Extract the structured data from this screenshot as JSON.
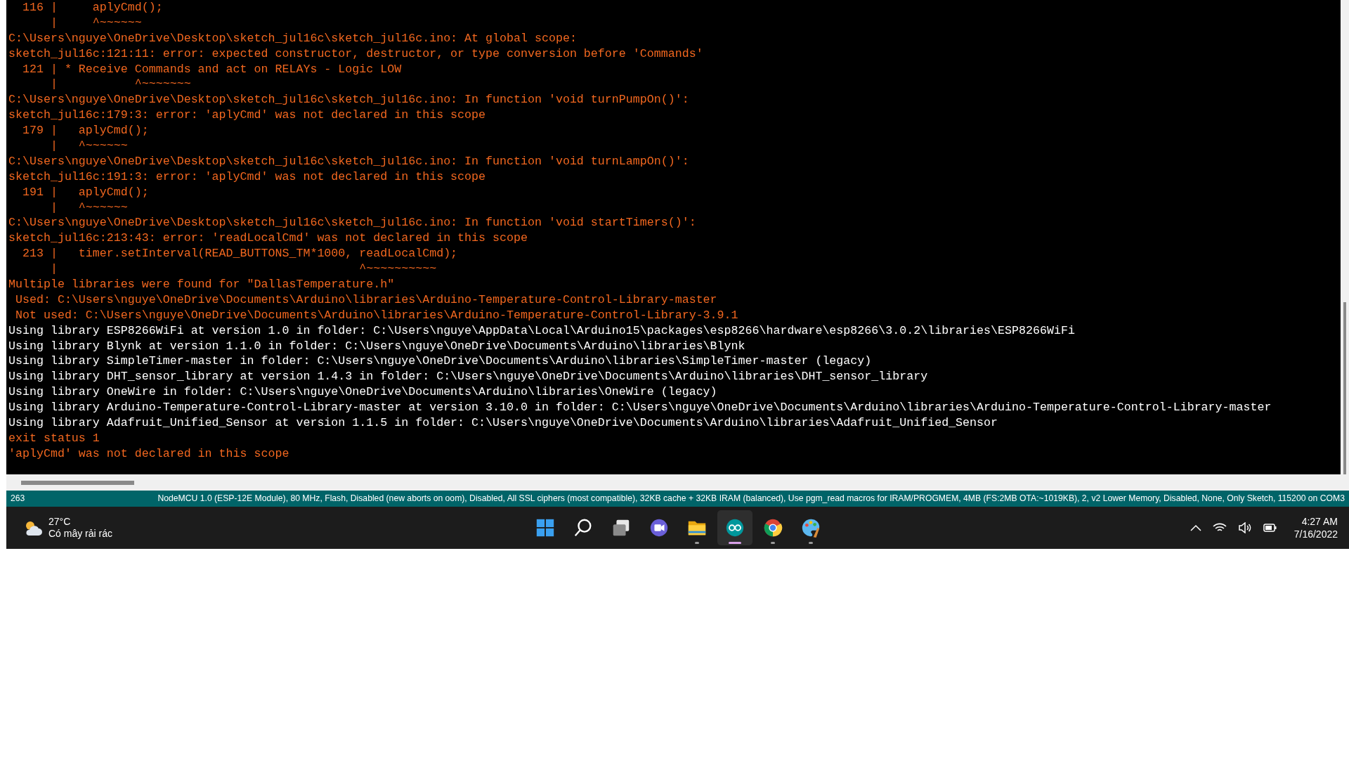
{
  "console": {
    "lines": [
      {
        "kind": "error",
        "text": "  116 |     aplyCmd();"
      },
      {
        "kind": "error",
        "text": "      |     ^~~~~~~"
      },
      {
        "kind": "error",
        "text": "C:\\Users\\nguye\\OneDrive\\Desktop\\sketch_jul16c\\sketch_jul16c.ino: At global scope:"
      },
      {
        "kind": "error",
        "text": "sketch_jul16c:121:11: error: expected constructor, destructor, or type conversion before 'Commands'"
      },
      {
        "kind": "error",
        "text": "  121 | * Receive Commands and act on RELAYs - Logic LOW"
      },
      {
        "kind": "error",
        "text": "      |           ^~~~~~~~"
      },
      {
        "kind": "error",
        "text": "C:\\Users\\nguye\\OneDrive\\Desktop\\sketch_jul16c\\sketch_jul16c.ino: In function 'void turnPumpOn()':"
      },
      {
        "kind": "error",
        "text": "sketch_jul16c:179:3: error: 'aplyCmd' was not declared in this scope"
      },
      {
        "kind": "error",
        "text": "  179 |   aplyCmd();"
      },
      {
        "kind": "error",
        "text": "      |   ^~~~~~~"
      },
      {
        "kind": "error",
        "text": "C:\\Users\\nguye\\OneDrive\\Desktop\\sketch_jul16c\\sketch_jul16c.ino: In function 'void turnLampOn()':"
      },
      {
        "kind": "error",
        "text": "sketch_jul16c:191:3: error: 'aplyCmd' was not declared in this scope"
      },
      {
        "kind": "error",
        "text": "  191 |   aplyCmd();"
      },
      {
        "kind": "error",
        "text": "      |   ^~~~~~~"
      },
      {
        "kind": "error",
        "text": "C:\\Users\\nguye\\OneDrive\\Desktop\\sketch_jul16c\\sketch_jul16c.ino: In function 'void startTimers()':"
      },
      {
        "kind": "error",
        "text": "sketch_jul16c:213:43: error: 'readLocalCmd' was not declared in this scope"
      },
      {
        "kind": "error",
        "text": "  213 |   timer.setInterval(READ_BUTTONS_TM*1000, readLocalCmd);"
      },
      {
        "kind": "error",
        "text": "      |                                           ^~~~~~~~~~~"
      },
      {
        "kind": "error",
        "text": "Multiple libraries were found for \"DallasTemperature.h\""
      },
      {
        "kind": "error",
        "text": " Used: C:\\Users\\nguye\\OneDrive\\Documents\\Arduino\\libraries\\Arduino-Temperature-Control-Library-master"
      },
      {
        "kind": "error",
        "text": " Not used: C:\\Users\\nguye\\OneDrive\\Documents\\Arduino\\libraries\\Arduino-Temperature-Control-Library-3.9.1"
      },
      {
        "kind": "info",
        "text": "Using library ESP8266WiFi at version 1.0 in folder: C:\\Users\\nguye\\AppData\\Local\\Arduino15\\packages\\esp8266\\hardware\\esp8266\\3.0.2\\libraries\\ESP8266WiFi"
      },
      {
        "kind": "info",
        "text": "Using library Blynk at version 1.1.0 in folder: C:\\Users\\nguye\\OneDrive\\Documents\\Arduino\\libraries\\Blynk"
      },
      {
        "kind": "info",
        "text": "Using library SimpleTimer-master in folder: C:\\Users\\nguye\\OneDrive\\Documents\\Arduino\\libraries\\SimpleTimer-master (legacy)"
      },
      {
        "kind": "info",
        "text": "Using library DHT_sensor_library at version 1.4.3 in folder: C:\\Users\\nguye\\OneDrive\\Documents\\Arduino\\libraries\\DHT_sensor_library"
      },
      {
        "kind": "info",
        "text": "Using library OneWire in folder: C:\\Users\\nguye\\OneDrive\\Documents\\Arduino\\libraries\\OneWire (legacy)"
      },
      {
        "kind": "info",
        "text": "Using library Arduino-Temperature-Control-Library-master at version 3.10.0 in folder: C:\\Users\\nguye\\OneDrive\\Documents\\Arduino\\libraries\\Arduino-Temperature-Control-Library-master"
      },
      {
        "kind": "info",
        "text": "Using library Adafruit_Unified_Sensor at version 1.1.5 in folder: C:\\Users\\nguye\\OneDrive\\Documents\\Arduino\\libraries\\Adafruit_Unified_Sensor"
      },
      {
        "kind": "error",
        "text": "exit status 1"
      },
      {
        "kind": "error",
        "text": "'aplyCmd' was not declared in this scope"
      }
    ]
  },
  "status_bar": {
    "line_number": "263",
    "board": "NodeMCU 1.0 (ESP-12E Module), 80 MHz, Flash, Disabled (new aborts on oom), Disabled, All SSL ciphers (most compatible), 32KB cache + 32KB IRAM (balanced), Use pgm_read macros for IRAM/PROGMEM, 4MB (FS:2MB OTA:~1019KB), 2, v2 Lower Memory, Disabled, None, Only Sketch, 115200 on COM3"
  },
  "taskbar": {
    "weather": {
      "temperature": "27°C",
      "condition": "Có mây rải rác"
    },
    "apps": [
      {
        "kind": "start",
        "selected": false,
        "running": false
      },
      {
        "kind": "search",
        "selected": false,
        "running": false
      },
      {
        "kind": "taskview",
        "selected": false,
        "running": false
      },
      {
        "kind": "chat",
        "selected": false,
        "running": false
      },
      {
        "kind": "files",
        "selected": false,
        "running": true
      },
      {
        "kind": "arduino",
        "selected": true,
        "running": true
      },
      {
        "kind": "browser",
        "selected": false,
        "running": true
      },
      {
        "kind": "paint",
        "selected": false,
        "running": true
      }
    ],
    "clock": {
      "time": "4:27 AM",
      "date": "7/16/2022"
    }
  }
}
